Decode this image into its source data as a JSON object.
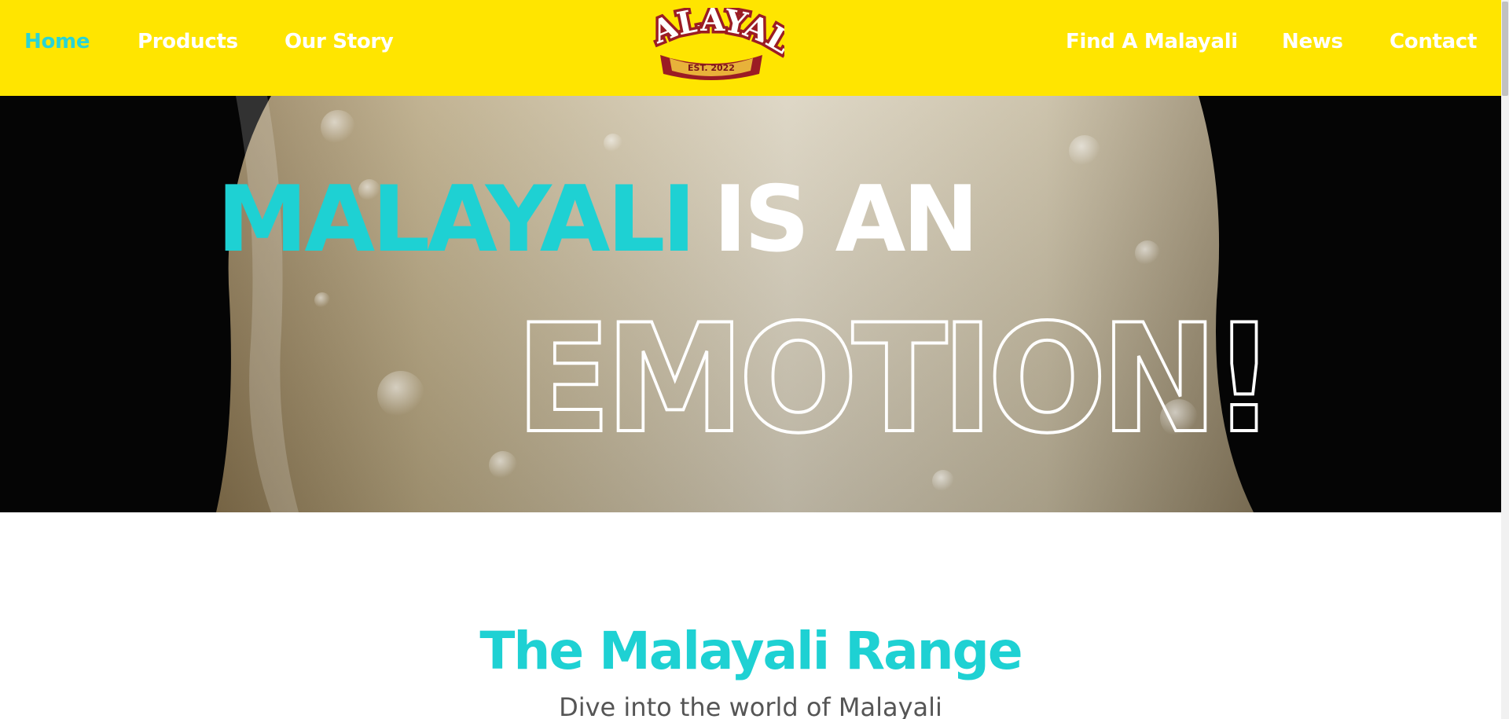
{
  "nav": {
    "left": [
      {
        "label": "Home",
        "active": true
      },
      {
        "label": "Products",
        "active": false
      },
      {
        "label": "Our Story",
        "active": false
      }
    ],
    "right": [
      {
        "label": "Find A Malayali"
      },
      {
        "label": "News"
      },
      {
        "label": "Contact"
      }
    ]
  },
  "logo": {
    "name": "MALAYALI",
    "tagline": "EST. 2022"
  },
  "hero": {
    "brand_word": "MALAYALI",
    "rest_words": "IS AN",
    "outline_word": "EMOTION!"
  },
  "range": {
    "title": "The Malayali Range",
    "subtitle": "Dive into the world of Malayali"
  },
  "colors": {
    "header_bg": "#ffe500",
    "accent": "#1ed1d3",
    "logo_red": "#9b1c24",
    "logo_gold": "#e8b23a"
  }
}
